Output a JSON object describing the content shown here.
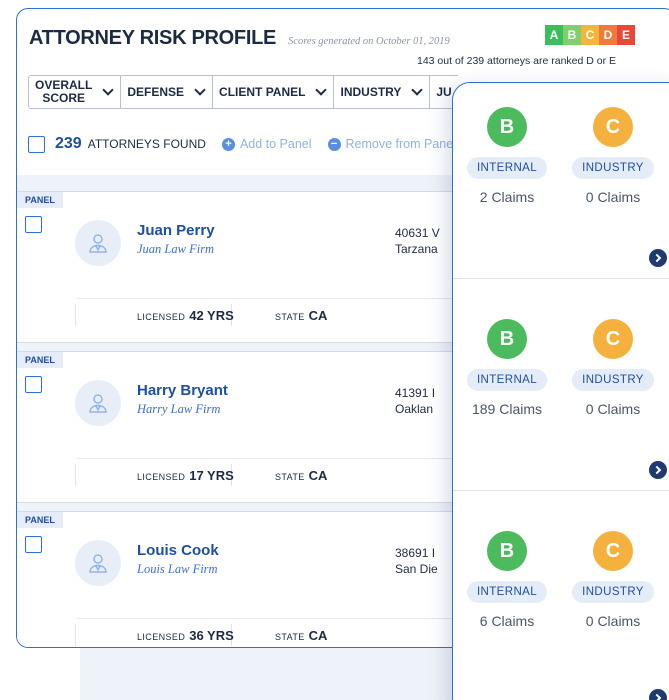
{
  "header": {
    "title": "ATTORNEY RISK PROFILE",
    "subtitle": "Scores generated on October 01, 2019",
    "rank_note": "143 out of 239 attorneys are ranked D or E"
  },
  "grade_legend": [
    {
      "letter": "A",
      "color": "#3bbf5c"
    },
    {
      "letter": "B",
      "color": "#7fcf6a"
    },
    {
      "letter": "C",
      "color": "#f2b63a"
    },
    {
      "letter": "D",
      "color": "#f07a3a"
    },
    {
      "letter": "E",
      "color": "#e8453b"
    }
  ],
  "filters": [
    {
      "line1": "OVERALL",
      "line2": "SCORE"
    },
    {
      "label": "DEFENSE"
    },
    {
      "label": "CLIENT PANEL"
    },
    {
      "label": "INDUSTRY"
    },
    {
      "label": "JU"
    }
  ],
  "toolbar": {
    "count": "239",
    "found_label": "ATTORNEYS FOUND",
    "add_label": "Add to Panel",
    "remove_label": "Remove from Panel"
  },
  "attorneys": [
    {
      "tag": "PANEL",
      "name": "Juan Perry",
      "firm": "Juan Law Firm",
      "addr1": "40631 V",
      "addr2": "Tarzana",
      "licensed_label": "LICENSED",
      "licensed": "42 YRS",
      "state_label": "STATE",
      "state": "CA"
    },
    {
      "tag": "PANEL",
      "name": "Harry Bryant",
      "firm": "Harry Law Firm",
      "addr1": "41391 I",
      "addr2": "Oaklan",
      "licensed_label": "LICENSED",
      "licensed": "17 YRS",
      "state_label": "STATE",
      "state": "CA"
    },
    {
      "tag": "PANEL",
      "name": "Louis Cook",
      "firm": "Louis Law Firm",
      "addr1": "38691 I",
      "addr2": "San Die",
      "licensed_label": "LICENSED",
      "licensed": "36 YRS",
      "state_label": "STATE",
      "state": "CA"
    }
  ],
  "score_cards": [
    {
      "internal_grade": "B",
      "internal_label": "INTERNAL",
      "internal_claims": "2 Claims",
      "industry_grade": "C",
      "industry_label": "INDUSTRY",
      "industry_claims": "0 Claims"
    },
    {
      "internal_grade": "B",
      "internal_label": "INTERNAL",
      "internal_claims": "189 Claims",
      "industry_grade": "C",
      "industry_label": "INDUSTRY",
      "industry_claims": "0 Claims"
    },
    {
      "internal_grade": "B",
      "internal_label": "INTERNAL",
      "internal_claims": "6 Claims",
      "industry_grade": "C",
      "industry_label": "INDUSTRY",
      "industry_claims": "0 Claims"
    }
  ],
  "colors": {
    "grade_b": "#4cbb5e",
    "grade_c": "#f5b13d",
    "accent": "#2f6fd6"
  }
}
